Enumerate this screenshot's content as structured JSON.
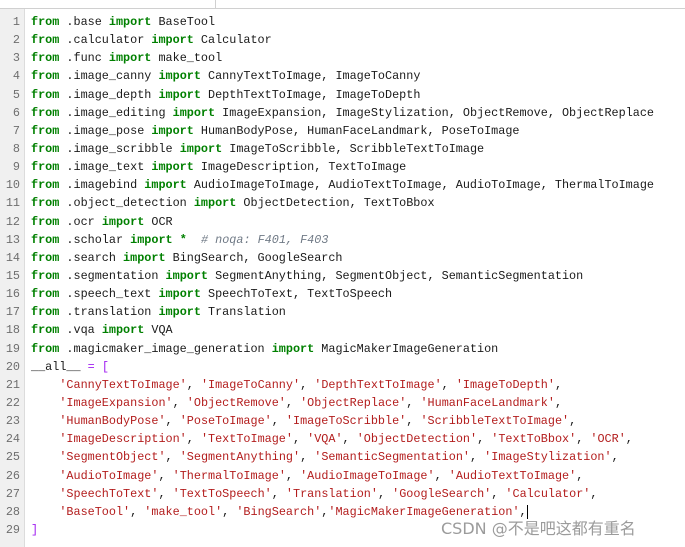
{
  "editor": {
    "lines": [
      {
        "n": "1",
        "segs": [
          [
            "k",
            "from"
          ],
          [
            "p",
            " .base "
          ],
          [
            "k",
            "import"
          ],
          [
            "p",
            " BaseTool"
          ]
        ]
      },
      {
        "n": "2",
        "segs": [
          [
            "k",
            "from"
          ],
          [
            "p",
            " .calculator "
          ],
          [
            "k",
            "import"
          ],
          [
            "p",
            " Calculator"
          ]
        ]
      },
      {
        "n": "3",
        "segs": [
          [
            "k",
            "from"
          ],
          [
            "p",
            " .func "
          ],
          [
            "k",
            "import"
          ],
          [
            "p",
            " make_tool"
          ]
        ]
      },
      {
        "n": "4",
        "segs": [
          [
            "k",
            "from"
          ],
          [
            "p",
            " .image_canny "
          ],
          [
            "k",
            "import"
          ],
          [
            "p",
            " CannyTextToImage, ImageToCanny"
          ]
        ]
      },
      {
        "n": "5",
        "segs": [
          [
            "k",
            "from"
          ],
          [
            "p",
            " .image_depth "
          ],
          [
            "k",
            "import"
          ],
          [
            "p",
            " DepthTextToImage, ImageToDepth"
          ]
        ]
      },
      {
        "n": "6",
        "segs": [
          [
            "k",
            "from"
          ],
          [
            "p",
            " .image_editing "
          ],
          [
            "k",
            "import"
          ],
          [
            "p",
            " ImageExpansion, ImageStylization, ObjectRemove, ObjectReplace"
          ]
        ]
      },
      {
        "n": "7",
        "segs": [
          [
            "k",
            "from"
          ],
          [
            "p",
            " .image_pose "
          ],
          [
            "k",
            "import"
          ],
          [
            "p",
            " HumanBodyPose, HumanFaceLandmark, PoseToImage"
          ]
        ]
      },
      {
        "n": "8",
        "segs": [
          [
            "k",
            "from"
          ],
          [
            "p",
            " .image_scribble "
          ],
          [
            "k",
            "import"
          ],
          [
            "p",
            " ImageToScribble, ScribbleTextToImage"
          ]
        ]
      },
      {
        "n": "9",
        "segs": [
          [
            "k",
            "from"
          ],
          [
            "p",
            " .image_text "
          ],
          [
            "k",
            "import"
          ],
          [
            "p",
            " ImageDescription, TextToImage"
          ]
        ]
      },
      {
        "n": "10",
        "segs": [
          [
            "k",
            "from"
          ],
          [
            "p",
            " .imagebind "
          ],
          [
            "k",
            "import"
          ],
          [
            "p",
            " AudioImageToImage, AudioTextToImage, AudioToImage, ThermalToImage"
          ]
        ]
      },
      {
        "n": "11",
        "segs": [
          [
            "k",
            "from"
          ],
          [
            "p",
            " .object_detection "
          ],
          [
            "k",
            "import"
          ],
          [
            "p",
            " ObjectDetection, TextToBbox"
          ]
        ]
      },
      {
        "n": "12",
        "segs": [
          [
            "k",
            "from"
          ],
          [
            "p",
            " .ocr "
          ],
          [
            "k",
            "import"
          ],
          [
            "p",
            " OCR"
          ]
        ]
      },
      {
        "n": "13",
        "segs": [
          [
            "k",
            "from"
          ],
          [
            "p",
            " .scholar "
          ],
          [
            "k",
            "import"
          ],
          [
            "p",
            " "
          ],
          [
            "k",
            "*"
          ],
          [
            "p",
            "  "
          ],
          [
            "c",
            "# noqa: F401, F403"
          ]
        ]
      },
      {
        "n": "14",
        "segs": [
          [
            "k",
            "from"
          ],
          [
            "p",
            " .search "
          ],
          [
            "k",
            "import"
          ],
          [
            "p",
            " BingSearch, GoogleSearch"
          ]
        ]
      },
      {
        "n": "15",
        "segs": [
          [
            "k",
            "from"
          ],
          [
            "p",
            " .segmentation "
          ],
          [
            "k",
            "import"
          ],
          [
            "p",
            " SegmentAnything, SegmentObject, SemanticSegmentation"
          ]
        ]
      },
      {
        "n": "16",
        "segs": [
          [
            "k",
            "from"
          ],
          [
            "p",
            " .speech_text "
          ],
          [
            "k",
            "import"
          ],
          [
            "p",
            " SpeechToText, TextToSpeech"
          ]
        ]
      },
      {
        "n": "17",
        "segs": [
          [
            "k",
            "from"
          ],
          [
            "p",
            " .translation "
          ],
          [
            "k",
            "import"
          ],
          [
            "p",
            " Translation"
          ]
        ]
      },
      {
        "n": "18",
        "segs": [
          [
            "k",
            "from"
          ],
          [
            "p",
            " .vqa "
          ],
          [
            "k",
            "import"
          ],
          [
            "p",
            " VQA"
          ]
        ]
      },
      {
        "n": "19",
        "segs": [
          [
            "k",
            "from"
          ],
          [
            "p",
            " .magicmaker_image_generation "
          ],
          [
            "k",
            "import"
          ],
          [
            "p",
            " MagicMakerImageGeneration"
          ]
        ]
      },
      {
        "n": "20",
        "segs": [
          [
            "p",
            "__all__ "
          ],
          [
            "o",
            "="
          ],
          [
            "p",
            " "
          ],
          [
            "o",
            "["
          ]
        ]
      },
      {
        "n": "21",
        "segs": [
          [
            "p",
            "    "
          ],
          [
            "s",
            "'CannyTextToImage'"
          ],
          [
            "p",
            ", "
          ],
          [
            "s",
            "'ImageToCanny'"
          ],
          [
            "p",
            ", "
          ],
          [
            "s",
            "'DepthTextToImage'"
          ],
          [
            "p",
            ", "
          ],
          [
            "s",
            "'ImageToDepth'"
          ],
          [
            "p",
            ","
          ]
        ]
      },
      {
        "n": "22",
        "segs": [
          [
            "p",
            "    "
          ],
          [
            "s",
            "'ImageExpansion'"
          ],
          [
            "p",
            ", "
          ],
          [
            "s",
            "'ObjectRemove'"
          ],
          [
            "p",
            ", "
          ],
          [
            "s",
            "'ObjectReplace'"
          ],
          [
            "p",
            ", "
          ],
          [
            "s",
            "'HumanFaceLandmark'"
          ],
          [
            "p",
            ","
          ]
        ]
      },
      {
        "n": "23",
        "segs": [
          [
            "p",
            "    "
          ],
          [
            "s",
            "'HumanBodyPose'"
          ],
          [
            "p",
            ", "
          ],
          [
            "s",
            "'PoseToImage'"
          ],
          [
            "p",
            ", "
          ],
          [
            "s",
            "'ImageToScribble'"
          ],
          [
            "p",
            ", "
          ],
          [
            "s",
            "'ScribbleTextToImage'"
          ],
          [
            "p",
            ","
          ]
        ]
      },
      {
        "n": "24",
        "segs": [
          [
            "p",
            "    "
          ],
          [
            "s",
            "'ImageDescription'"
          ],
          [
            "p",
            ", "
          ],
          [
            "s",
            "'TextToImage'"
          ],
          [
            "p",
            ", "
          ],
          [
            "s",
            "'VQA'"
          ],
          [
            "p",
            ", "
          ],
          [
            "s",
            "'ObjectDetection'"
          ],
          [
            "p",
            ", "
          ],
          [
            "s",
            "'TextToBbox'"
          ],
          [
            "p",
            ", "
          ],
          [
            "s",
            "'OCR'"
          ],
          [
            "p",
            ","
          ]
        ]
      },
      {
        "n": "25",
        "segs": [
          [
            "p",
            "    "
          ],
          [
            "s",
            "'SegmentObject'"
          ],
          [
            "p",
            ", "
          ],
          [
            "s",
            "'SegmentAnything'"
          ],
          [
            "p",
            ", "
          ],
          [
            "s",
            "'SemanticSegmentation'"
          ],
          [
            "p",
            ", "
          ],
          [
            "s",
            "'ImageStylization'"
          ],
          [
            "p",
            ","
          ]
        ]
      },
      {
        "n": "26",
        "segs": [
          [
            "p",
            "    "
          ],
          [
            "s",
            "'AudioToImage'"
          ],
          [
            "p",
            ", "
          ],
          [
            "s",
            "'ThermalToImage'"
          ],
          [
            "p",
            ", "
          ],
          [
            "s",
            "'AudioImageToImage'"
          ],
          [
            "p",
            ", "
          ],
          [
            "s",
            "'AudioTextToImage'"
          ],
          [
            "p",
            ","
          ]
        ]
      },
      {
        "n": "27",
        "segs": [
          [
            "p",
            "    "
          ],
          [
            "s",
            "'SpeechToText'"
          ],
          [
            "p",
            ", "
          ],
          [
            "s",
            "'TextToSpeech'"
          ],
          [
            "p",
            ", "
          ],
          [
            "s",
            "'Translation'"
          ],
          [
            "p",
            ", "
          ],
          [
            "s",
            "'GoogleSearch'"
          ],
          [
            "p",
            ", "
          ],
          [
            "s",
            "'Calculator'"
          ],
          [
            "p",
            ","
          ]
        ]
      },
      {
        "n": "28",
        "segs": [
          [
            "p",
            "    "
          ],
          [
            "s",
            "'BaseTool'"
          ],
          [
            "p",
            ", "
          ],
          [
            "s",
            "'make_tool'"
          ],
          [
            "p",
            ", "
          ],
          [
            "s",
            "'BingSearch'"
          ],
          [
            "p",
            ","
          ],
          [
            "s",
            "'MagicMakerImageGeneration'"
          ],
          [
            "p",
            ","
          ]
        ]
      },
      {
        "n": "29",
        "segs": [
          [
            "o",
            "]"
          ]
        ]
      }
    ],
    "cursor_line": "28"
  },
  "colors": {
    "keyword": "#008000",
    "string": "#b31d1d",
    "comment": "#707a86",
    "operator": "#a020f0",
    "gutter": "#f0f0f0"
  },
  "watermark": "CSDN @不是吧这都有重名"
}
